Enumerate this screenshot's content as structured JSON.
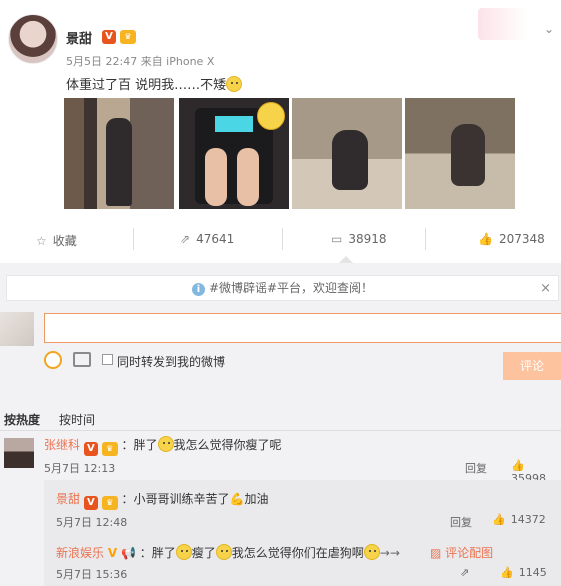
{
  "post": {
    "author": "景甜",
    "vip_badge": "V",
    "meta": "5月5日 22:47 来自 iPhone X",
    "text": "体重过了百 说明我……不矮",
    "photo_count": 4
  },
  "actions": {
    "favorite_label": "收藏",
    "forward_count": "47641",
    "comment_count": "38918",
    "like_count": "207348"
  },
  "notice": {
    "text": "#微博辟谣#平台，欢迎查阅！",
    "close": "×"
  },
  "compose": {
    "input_value": "",
    "forward_label": "同时转发到我的微博",
    "submit_label": "评论"
  },
  "sort": {
    "hot_label": "按热度",
    "time_label": "按时间"
  },
  "comments": [
    {
      "name": "张继科",
      "text_a": "：胖了",
      "text_b": "我怎么觉得你瘦了呢",
      "time": "5月7日 12:13",
      "reply_label": "回复",
      "likes": "35998"
    }
  ],
  "replies": [
    {
      "name": "景甜",
      "text_a": "：小哥哥训练辛苦了",
      "text_b": "加油",
      "time": "5月7日 12:48",
      "reply_label": "回复",
      "likes": "14372"
    },
    {
      "name": "新浪娱乐",
      "text_a": "：胖了",
      "text_b": "瘦了",
      "text_c": "我怎么觉得你们在虐狗啊",
      "text_d": "→→",
      "config_label": "评论配图",
      "time": "5月7日 15:36",
      "likes": "1145"
    }
  ],
  "colors": {
    "accent": "#eb7350",
    "input_border": "#f09a63",
    "submit_bg": "#fdc39e",
    "panel_bg": "#f2f2f5"
  },
  "icons": [
    "star-icon",
    "forward-icon",
    "comment-icon",
    "like-icon",
    "info-icon",
    "face-icon",
    "picture-icon"
  ]
}
